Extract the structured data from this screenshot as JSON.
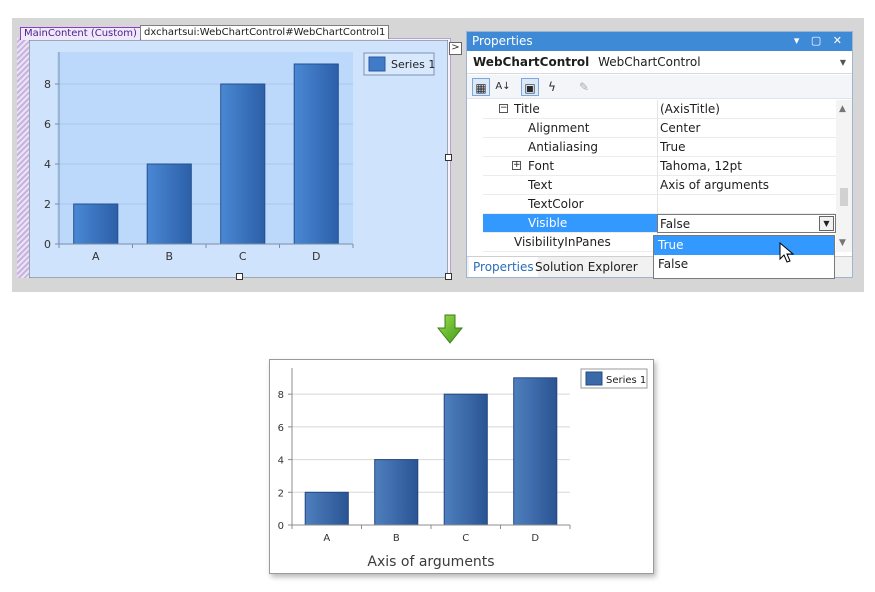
{
  "designer": {
    "tag_main": "MainContent (Custom)",
    "tag_control": "dxchartsui:WebChartControl#WebChartControl1",
    "smart_tag_glyph": ">"
  },
  "properties": {
    "title": "Properties",
    "titlebar_icons": "▾ ▢ ✕",
    "object_name": "WebChartControl",
    "object_type": "WebChartControl",
    "rows": [
      {
        "name": "Title",
        "value": "(AxisTitle)",
        "expander": "−"
      },
      {
        "name": "Alignment",
        "value": "Center"
      },
      {
        "name": "Antialiasing",
        "value": "True"
      },
      {
        "name": "Font",
        "value": "Tahoma, 12pt",
        "expander": "+"
      },
      {
        "name": "Text",
        "value": "Axis of arguments"
      },
      {
        "name": "TextColor",
        "value": ""
      },
      {
        "name": "Visible",
        "value": "False"
      },
      {
        "name": "VisibilityInPanes",
        "value": ""
      }
    ],
    "dropdown_options": [
      "True",
      "False"
    ],
    "tabs": [
      "Properties",
      "Solution Explorer"
    ]
  },
  "colors": {
    "accent": "#3e8ad6",
    "selection": "#3399ff",
    "bar_top": "#3f7bc6",
    "bar_bottom": "#2a5aa2",
    "designer_plot_bg": "#bcd9fb",
    "arrow_green": "#5fb321"
  },
  "chart_data": [
    {
      "type": "bar",
      "categories": [
        "A",
        "B",
        "C",
        "D"
      ],
      "series": [
        {
          "name": "Series 1",
          "values": [
            2,
            4,
            8,
            9
          ]
        }
      ],
      "yticks": [
        0,
        2,
        4,
        6,
        8
      ],
      "ylim": [
        0,
        9.6
      ],
      "xlabel": "",
      "legend": "top-right"
    },
    {
      "type": "bar",
      "categories": [
        "A",
        "B",
        "C",
        "D"
      ],
      "series": [
        {
          "name": "Series 1",
          "values": [
            2,
            4,
            8,
            9
          ]
        }
      ],
      "yticks": [
        0,
        2,
        4,
        6,
        8
      ],
      "ylim": [
        0,
        9.6
      ],
      "xlabel": "Axis of arguments",
      "legend": "top-right"
    }
  ]
}
